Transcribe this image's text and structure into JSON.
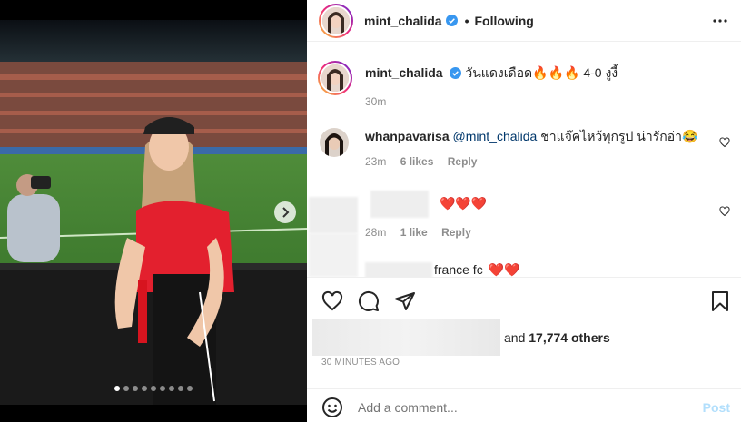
{
  "header": {
    "username": "mint_chalida",
    "separator": "•",
    "follow_status": "Following"
  },
  "caption": {
    "username": "mint_chalida",
    "text": "วันแดงเดือด🔥🔥🔥 4-0 งูงี้",
    "time": "30m"
  },
  "comments": [
    {
      "username": "whanpavarisa",
      "mention": "@mint_chalida",
      "text": "ชาแจ๊คไหว้ทุกรูป น่ารักอ่า😂",
      "time": "23m",
      "likes": "6 likes",
      "reply": "Reply"
    },
    {
      "username": "",
      "text": "❤️❤️❤️",
      "time": "28m",
      "likes": "1 like",
      "reply": "Reply"
    },
    {
      "username": "france fc",
      "text": "❤️❤️"
    }
  ],
  "likes": {
    "prefix": "and",
    "count": "17,774 others"
  },
  "timestamp": "30 MINUTES AGO",
  "comment_box": {
    "placeholder": "Add a comment...",
    "post_label": "Post"
  },
  "carousel": {
    "total": 9,
    "active": 0
  },
  "colors": {
    "verified": "#3897f0",
    "post_disabled": "#b2dffc",
    "jersey": "#e3202e"
  },
  "icons": [
    "verified-badge-icon",
    "more-icon",
    "heart-icon",
    "comment-icon",
    "share-icon",
    "bookmark-icon",
    "emoji-icon",
    "chevron-right-icon"
  ]
}
